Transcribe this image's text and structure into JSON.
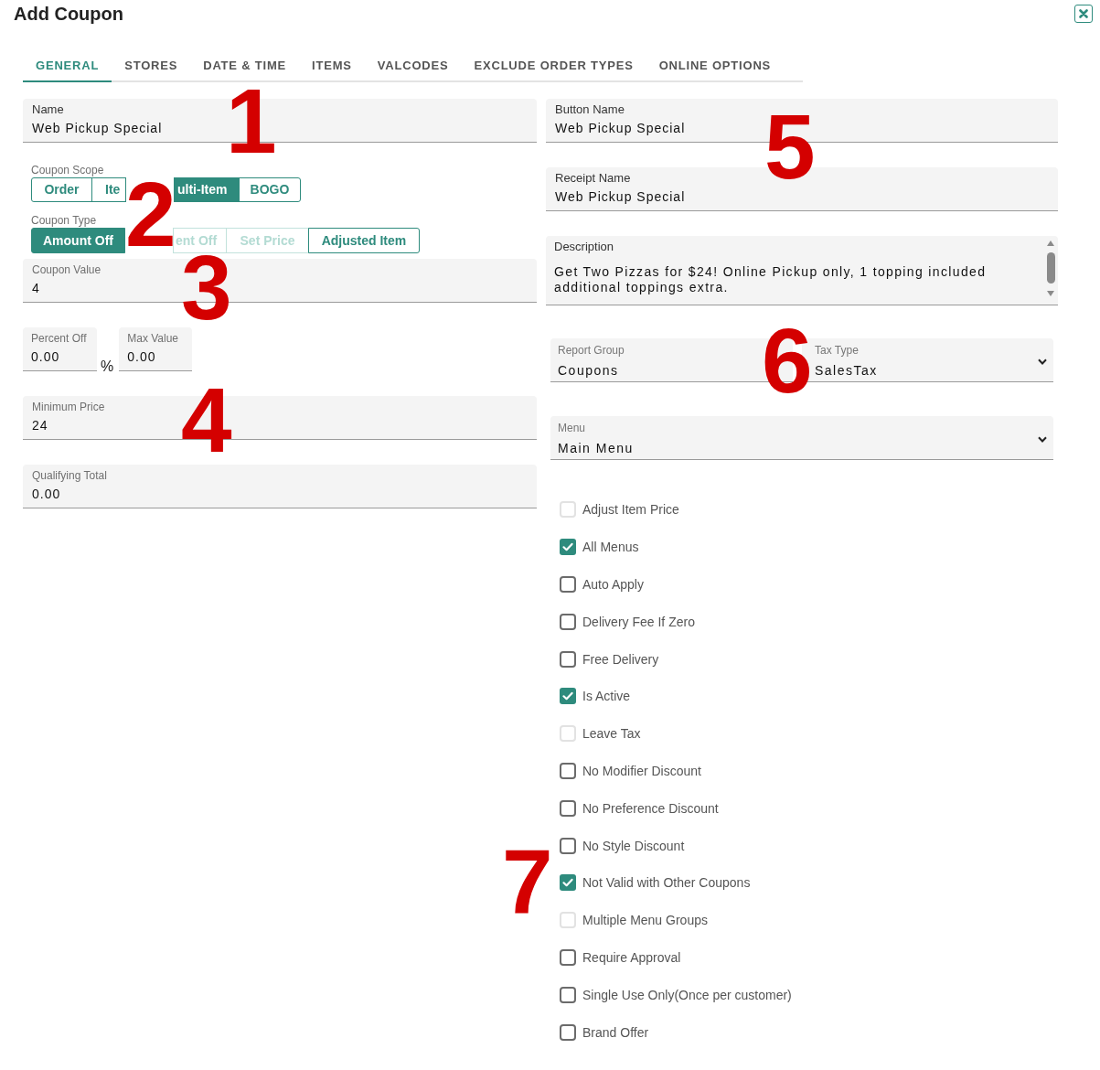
{
  "window": {
    "title": "Add Coupon"
  },
  "tabs": [
    {
      "label": "GENERAL",
      "selected": true
    },
    {
      "label": "STORES",
      "selected": false
    },
    {
      "label": "DATE & TIME",
      "selected": false
    },
    {
      "label": "ITEMS",
      "selected": false
    },
    {
      "label": "VALCODES",
      "selected": false
    },
    {
      "label": "EXCLUDE ORDER TYPES",
      "selected": false
    },
    {
      "label": "ONLINE OPTIONS",
      "selected": false
    }
  ],
  "general": {
    "name": {
      "label": "Name",
      "value": "Web Pickup Special"
    },
    "coupon_scope": {
      "label": "Coupon Scope",
      "options": [
        {
          "label": "Order",
          "selected": false
        },
        {
          "label": "Ite",
          "selected": false
        },
        {
          "label": "ulti-Item",
          "selected": true
        },
        {
          "label": "BOGO",
          "selected": false
        }
      ]
    },
    "coupon_type": {
      "label": "Coupon Type",
      "options": [
        {
          "label": "Amount Off",
          "selected": true,
          "disabled": false
        },
        {
          "label": "ent Off",
          "selected": false,
          "disabled": true
        },
        {
          "label": "Set Price",
          "selected": false,
          "disabled": true
        },
        {
          "label": "Adjusted Item",
          "selected": false,
          "disabled": false
        }
      ]
    },
    "coupon_value": {
      "label": "Coupon Value",
      "value": "4"
    },
    "percent_off": {
      "label": "Percent Off",
      "value": "0.00",
      "suffix": "%"
    },
    "max_value": {
      "label": "Max Value",
      "value": "0.00"
    },
    "minimum_price": {
      "label": "Minimum Price",
      "value": "24"
    },
    "qualifying_total": {
      "label": "Qualifying Total",
      "value": "0.00"
    },
    "button_name": {
      "label": "Button Name",
      "value": "Web Pickup Special"
    },
    "receipt_name": {
      "label": "Receipt Name",
      "value": "Web Pickup Special"
    },
    "description": {
      "label": "Description",
      "value": "Get Two Pizzas for $24! Online Pickup only, 1 topping included additional toppings extra."
    },
    "report_group": {
      "label": "Report Group",
      "value": "Coupons"
    },
    "tax_type": {
      "label": "Tax Type",
      "value": "SalesTax"
    },
    "menu": {
      "label": "Menu",
      "value": "Main Menu"
    },
    "options": [
      {
        "label": "Adjust Item Price",
        "checked": false,
        "disabled": true
      },
      {
        "label": "All Menus",
        "checked": true,
        "disabled": false
      },
      {
        "label": "Auto Apply",
        "checked": false,
        "disabled": false
      },
      {
        "label": "Delivery Fee If Zero",
        "checked": false,
        "disabled": false
      },
      {
        "label": "Free Delivery",
        "checked": false,
        "disabled": false
      },
      {
        "label": "Is Active",
        "checked": true,
        "disabled": false
      },
      {
        "label": "Leave Tax",
        "checked": false,
        "disabled": true
      },
      {
        "label": "No Modifier Discount",
        "checked": false,
        "disabled": false
      },
      {
        "label": "No Preference Discount",
        "checked": false,
        "disabled": false
      },
      {
        "label": "No Style Discount",
        "checked": false,
        "disabled": false
      },
      {
        "label": "Not Valid with Other Coupons",
        "checked": true,
        "disabled": false
      },
      {
        "label": "Multiple Menu Groups",
        "checked": false,
        "disabled": true
      },
      {
        "label": "Require Approval",
        "checked": false,
        "disabled": false
      },
      {
        "label": "Single Use Only(Once per customer)",
        "checked": false,
        "disabled": false
      },
      {
        "label": "Brand Offer",
        "checked": false,
        "disabled": false
      }
    ]
  },
  "annotations": [
    {
      "label": "1"
    },
    {
      "label": "2"
    },
    {
      "label": "3"
    },
    {
      "label": "4"
    },
    {
      "label": "5"
    },
    {
      "label": "6"
    },
    {
      "label": "7"
    }
  ]
}
